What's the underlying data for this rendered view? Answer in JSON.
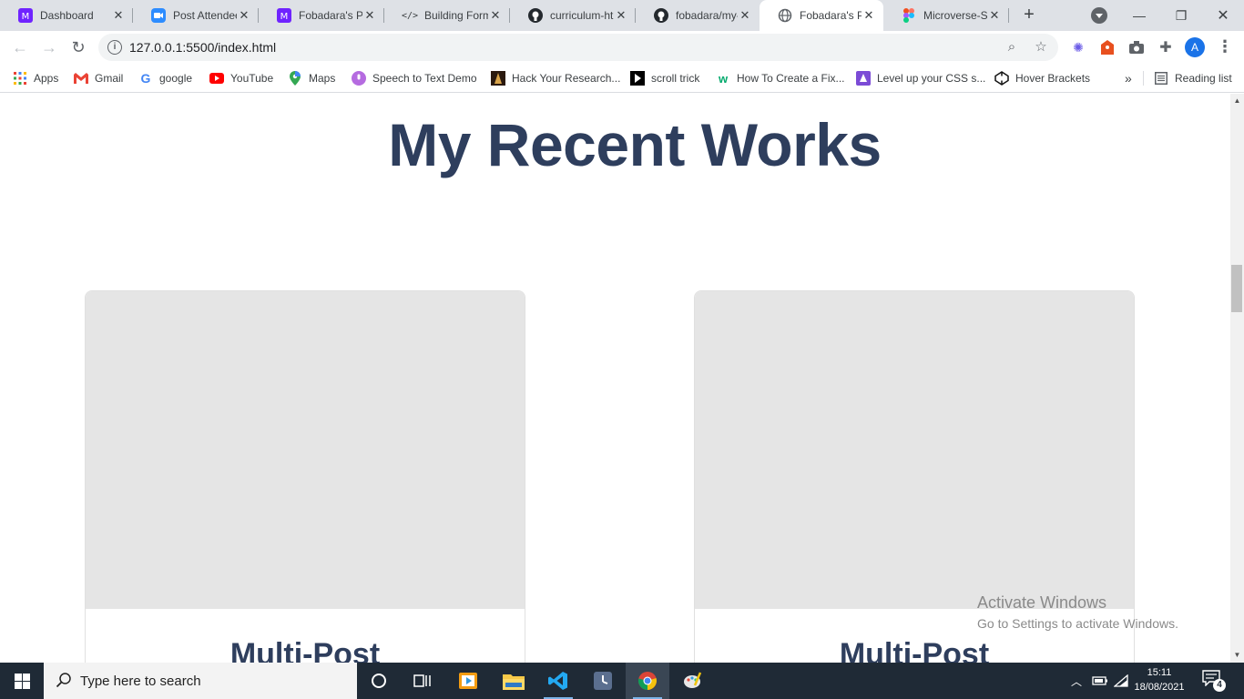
{
  "tabs": [
    {
      "title": "Dashboard",
      "icon": "microverse-icon"
    },
    {
      "title": "Post Attendee",
      "icon": "zoom-icon"
    },
    {
      "title": "Fobadara's Pr",
      "icon": "microverse-icon"
    },
    {
      "title": "Building Form",
      "icon": "code-icon"
    },
    {
      "title": "curriculum-ht",
      "icon": "github-icon"
    },
    {
      "title": "fobadara/my-",
      "icon": "github-icon"
    },
    {
      "title": "Fobadara's Po",
      "icon": "globe-icon"
    },
    {
      "title": "Microverse-St",
      "icon": "figma-icon"
    }
  ],
  "active_tab": 6,
  "address": {
    "url": "127.0.0.1:5500/index.html"
  },
  "profile": {
    "initial": "A"
  },
  "bookmarks": [
    {
      "label": "Apps",
      "icon": "apps-grid-icon"
    },
    {
      "label": "Gmail",
      "icon": "gmail-icon"
    },
    {
      "label": "google",
      "icon": "google-icon"
    },
    {
      "label": "YouTube",
      "icon": "youtube-icon"
    },
    {
      "label": "Maps",
      "icon": "maps-icon"
    },
    {
      "label": "Speech to Text Demo",
      "icon": "speech-icon"
    },
    {
      "label": "Hack Your Research...",
      "icon": "bookmark-icon"
    },
    {
      "label": "scroll trick",
      "icon": "bookmark-icon"
    },
    {
      "label": "How To Create a Fix...",
      "icon": "w3schools-icon"
    },
    {
      "label": "Level up your CSS s...",
      "icon": "bookmark-icon"
    },
    {
      "label": "Hover Brackets",
      "icon": "codepen-icon"
    }
  ],
  "bookmarks_overflow": "»",
  "reading_list": "Reading list",
  "page": {
    "heading": "My Recent Works",
    "cards": [
      {
        "title": "Multi-Post"
      },
      {
        "title": "Multi-Post"
      }
    ]
  },
  "watermark": {
    "line1": "Activate Windows",
    "line2": "Go to Settings to activate Windows."
  },
  "taskbar": {
    "search_placeholder": "Type here to search",
    "time": "15:11",
    "date": "18/08/2021",
    "notifications": "4"
  },
  "colors": {
    "heading": "#2e3e5d",
    "card_image": "#e5e5e5",
    "taskbar": "#1f2a36"
  }
}
